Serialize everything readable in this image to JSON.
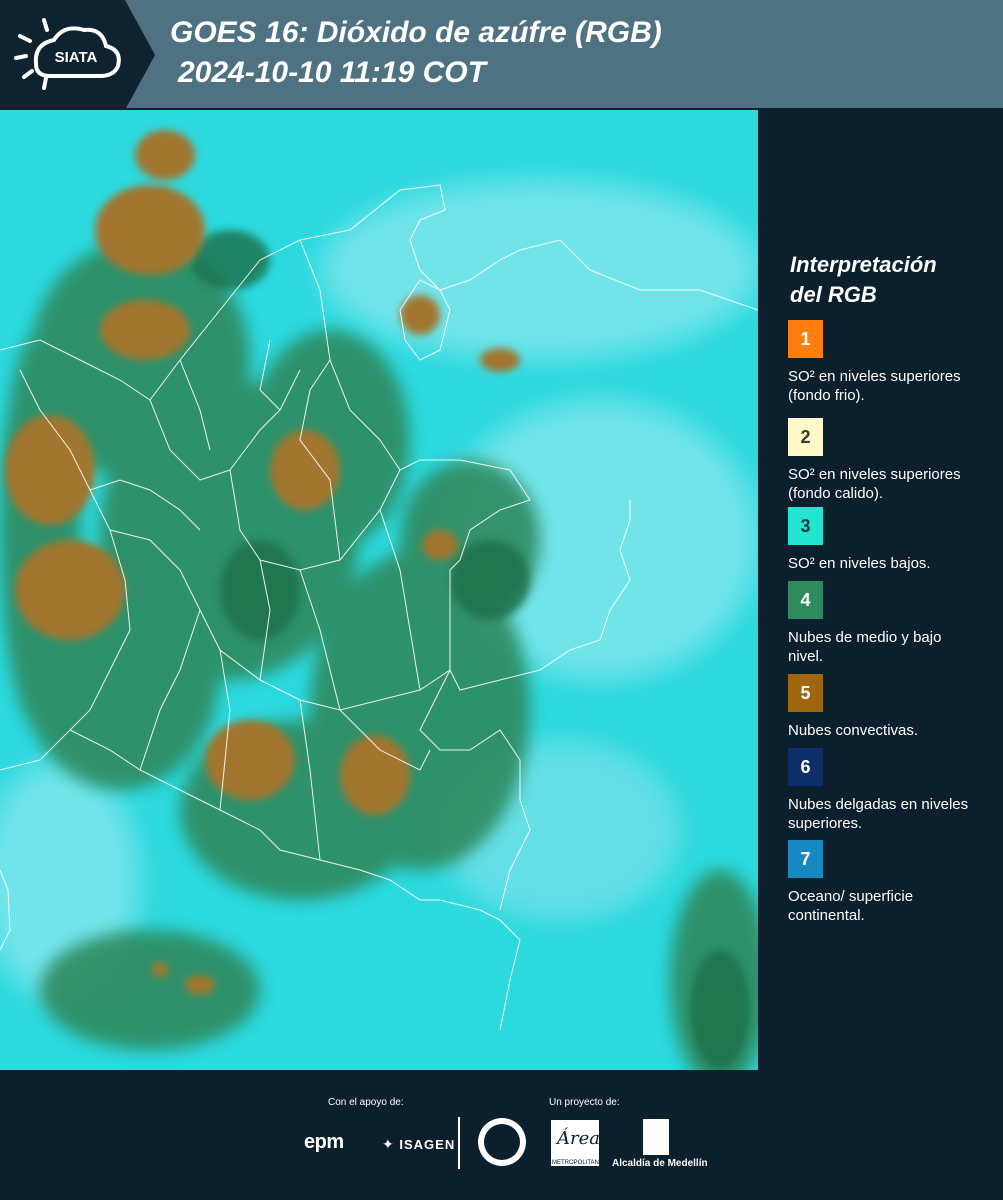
{
  "header": {
    "logo_text": "SIATA",
    "title": "GOES 16: Dióxido de azúfre (RGB)",
    "subtitle": "2024-10-10 11:19 COT"
  },
  "legend": {
    "title_line1": "Interpretación",
    "title_line2": "del RGB",
    "items": [
      {
        "number": "1",
        "color": "#ff7f0e",
        "text_color": "#ffffff",
        "label": "SO² en niveles superiores (fondo frio)."
      },
      {
        "number": "2",
        "color": "#fff8c8",
        "text_color": "#3a3a3a",
        "label": "SO² en niveles superiores (fondo calido)."
      },
      {
        "number": "3",
        "color": "#22e6d0",
        "text_color": "#1a3a3a",
        "label": "SO² en niveles bajos."
      },
      {
        "number": "4",
        "color": "#2f8a5e",
        "text_color": "#ffffff",
        "label": "Nubes de medio y bajo nivel."
      },
      {
        "number": "5",
        "color": "#a0660f",
        "text_color": "#ffffff",
        "label": "Nubes convectivas."
      },
      {
        "number": "6",
        "color": "#0e2e6a",
        "text_color": "#ffffff",
        "label": "Nubes delgadas en niveles superiores."
      },
      {
        "number": "7",
        "color": "#1888c0",
        "text_color": "#ffffff",
        "label": "Oceano/ superficie continental."
      }
    ]
  },
  "footer": {
    "support_label": "Con el apoyo de:",
    "project_label": "Un proyecto de:",
    "epm": "epm",
    "isagen": "ISAGEN",
    "area": "Área",
    "area_sub": "METROPOLITANA Valle de Aburrá",
    "alcaldia": "Alcaldía de Medellín"
  },
  "map_colors": {
    "background": "#2bd9df",
    "haze": "#8fe9ef",
    "green": "#2f8a5e",
    "dark_green": "#20704a",
    "brown": "#a2762e",
    "borders": "#ffffff"
  }
}
